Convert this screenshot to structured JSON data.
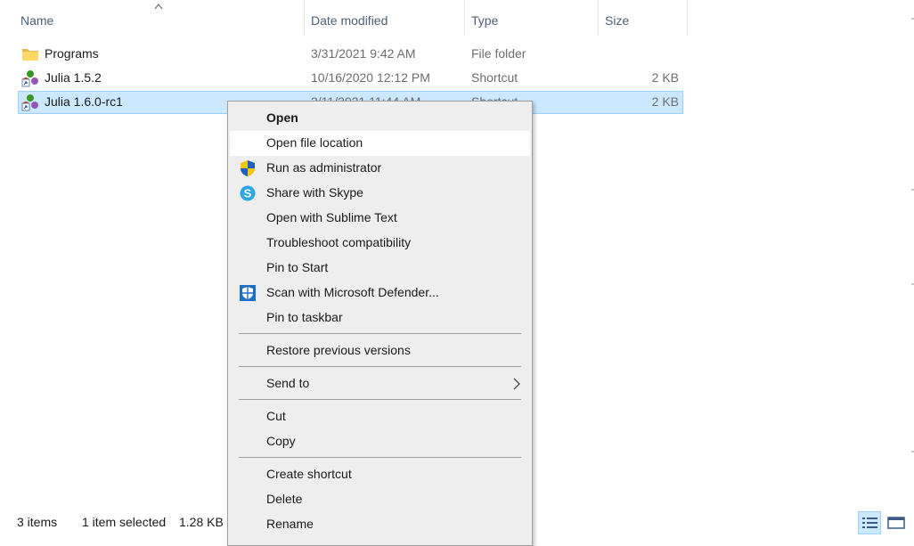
{
  "columns": {
    "name": "Name",
    "date_modified": "Date modified",
    "type": "Type",
    "size": "Size"
  },
  "files": [
    {
      "name": "Programs",
      "date": "3/31/2021 9:42 AM",
      "type": "File folder",
      "size": "",
      "icon": "folder-icon",
      "selected": false
    },
    {
      "name": "Julia 1.5.2",
      "date": "10/16/2020 12:12 PM",
      "type": "Shortcut",
      "size": "2 KB",
      "icon": "julia-shortcut-icon",
      "selected": false
    },
    {
      "name": "Julia 1.6.0-rc1",
      "date": "3/11/2021 11:44 AM",
      "type": "Shortcut",
      "size": "2 KB",
      "icon": "julia-shortcut-icon",
      "selected": true
    }
  ],
  "status": {
    "item_count": "3 items",
    "selection": "1 item selected",
    "selection_size": "1.28 KB"
  },
  "context_menu": {
    "open": "Open",
    "open_file_location": "Open file location",
    "run_as_admin": "Run as administrator",
    "share_skype": "Share with Skype",
    "open_sublime": "Open with Sublime Text",
    "troubleshoot": "Troubleshoot compatibility",
    "pin_start": "Pin to Start",
    "scan_defender": "Scan with Microsoft Defender...",
    "pin_taskbar": "Pin to taskbar",
    "restore_versions": "Restore previous versions",
    "send_to": "Send to",
    "cut": "Cut",
    "copy": "Copy",
    "create_shortcut": "Create shortcut",
    "delete": "Delete",
    "rename": "Rename"
  },
  "colors": {
    "selection": "#cce8ff",
    "selection_border": "#99d1ff",
    "menu_bg": "#eeeeee",
    "header_text": "#4c607a"
  }
}
